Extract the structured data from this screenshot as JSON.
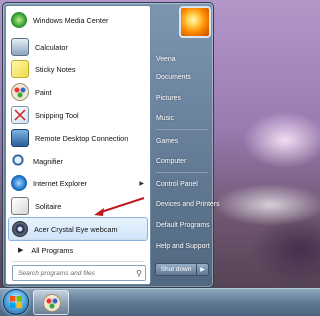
{
  "programs": [
    {
      "label": "Windows Media Center",
      "icon": "windows-media-center-icon"
    },
    {
      "label": "Calculator",
      "icon": "calculator-icon"
    },
    {
      "label": "Sticky Notes",
      "icon": "sticky-notes-icon"
    },
    {
      "label": "Paint",
      "icon": "paint-icon"
    },
    {
      "label": "Snipping Tool",
      "icon": "snipping-tool-icon"
    },
    {
      "label": "Remote Desktop Connection",
      "icon": "remote-desktop-icon"
    },
    {
      "label": "Magnifier",
      "icon": "magnifier-icon"
    },
    {
      "label": "Internet Explorer",
      "icon": "internet-explorer-icon"
    },
    {
      "label": "Solitaire",
      "icon": "solitaire-icon"
    },
    {
      "label": "Acer Crystal Eye webcam",
      "icon": "webcam-icon"
    }
  ],
  "all_programs": "All Programs",
  "search": {
    "placeholder": "Search programs and files"
  },
  "right_menu": [
    "Veena",
    "Documents",
    "Pictures",
    "Music",
    "Games",
    "Computer",
    "Control Panel",
    "Devices and Printers",
    "Default Programs",
    "Help and Support"
  ],
  "shutdown_label": "Shut down",
  "colors": {
    "highlight": "#cfe4fb",
    "arrow": "#c0191d"
  }
}
